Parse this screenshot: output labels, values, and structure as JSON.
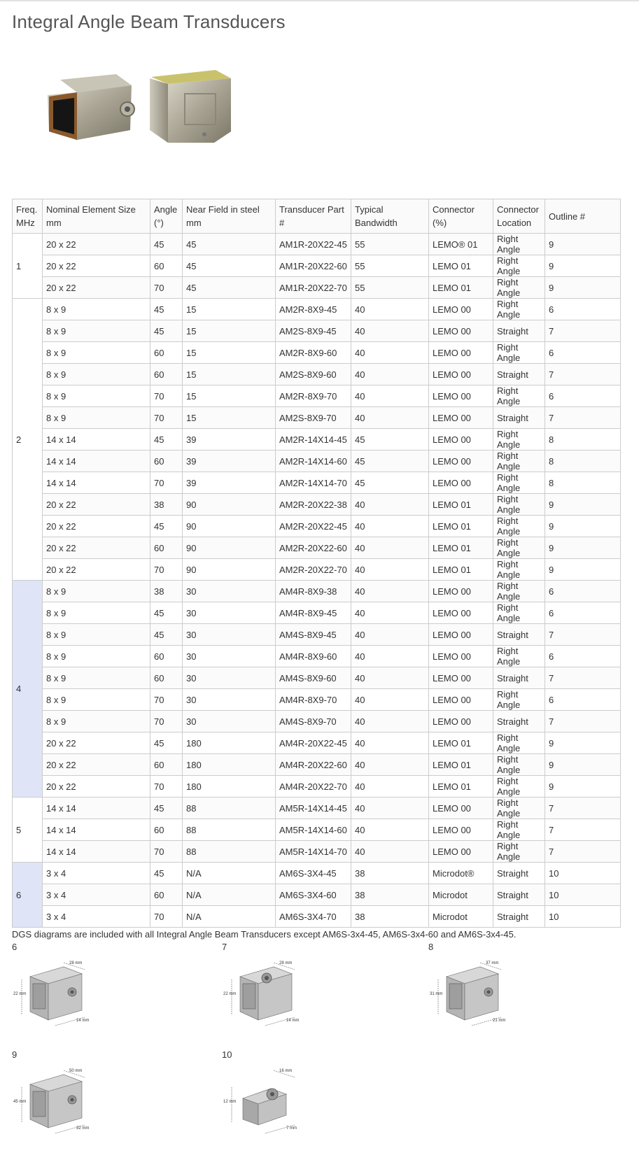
{
  "page": {
    "title": "Integral Angle Beam Transducers"
  },
  "table": {
    "headers": [
      "Freq. MHz",
      "Nominal Element Size mm",
      "Angle (°)",
      "Near Field in steel mm",
      "Transducer Part #",
      "Typical Bandwidth",
      "Connector (%)",
      "Connector Location",
      "Outline #"
    ],
    "groups": [
      {
        "freq": "1",
        "rows": [
          [
            "20 x 22",
            "45",
            "45",
            "AM1R-20X22-45",
            "55",
            "LEMO® 01",
            "Right Angle",
            "9"
          ],
          [
            "20 x 22",
            "60",
            "45",
            "AM1R-20X22-60",
            "55",
            "LEMO 01",
            "Right Angle",
            "9"
          ],
          [
            "20 x 22",
            "70",
            "45",
            "AM1R-20X22-70",
            "55",
            "LEMO 01",
            "Right Angle",
            "9"
          ]
        ]
      },
      {
        "freq": "2",
        "rows": [
          [
            "8 x 9",
            "45",
            "15",
            "AM2R-8X9-45",
            "40",
            "LEMO 00",
            "Right Angle",
            "6"
          ],
          [
            "8 x 9",
            "45",
            "15",
            "AM2S-8X9-45",
            "40",
            "LEMO 00",
            "Straight",
            "7"
          ],
          [
            "8 x 9",
            "60",
            "15",
            "AM2R-8X9-60",
            "40",
            "LEMO 00",
            "Right Angle",
            "6"
          ],
          [
            "8 x 9",
            "60",
            "15",
            "AM2S-8X9-60",
            "40",
            "LEMO 00",
            "Straight",
            "7"
          ],
          [
            "8 x 9",
            "70",
            "15",
            "AM2R-8X9-70",
            "40",
            "LEMO 00",
            "Right Angle",
            "6"
          ],
          [
            "8 x 9",
            "70",
            "15",
            "AM2S-8X9-70",
            "40",
            "LEMO 00",
            "Straight",
            "7"
          ],
          [
            "14 x 14",
            "45",
            "39",
            "AM2R-14X14-45",
            "45",
            "LEMO 00",
            "Right Angle",
            "8"
          ],
          [
            "14 x 14",
            "60",
            "39",
            "AM2R-14X14-60",
            "45",
            "LEMO 00",
            "Right Angle",
            "8"
          ],
          [
            "14 x 14",
            "70",
            "39",
            "AM2R-14X14-70",
            "45",
            "LEMO 00",
            "Right Angle",
            "8"
          ],
          [
            "20 x 22",
            "38",
            "90",
            "AM2R-20X22-38",
            "40",
            "LEMO 01",
            "Right Angle",
            "9"
          ],
          [
            "20 x 22",
            "45",
            "90",
            "AM2R-20X22-45",
            "40",
            "LEMO 01",
            "Right Angle",
            "9"
          ],
          [
            "20 x 22",
            "60",
            "90",
            "AM2R-20X22-60",
            "40",
            "LEMO 01",
            "Right Angle",
            "9"
          ],
          [
            "20 x 22",
            "70",
            "90",
            "AM2R-20X22-70",
            "40",
            "LEMO 01",
            "Right Angle",
            "9"
          ]
        ]
      },
      {
        "freq": "4",
        "rows": [
          [
            "8 x 9",
            "38",
            "30",
            "AM4R-8X9-38",
            "40",
            "LEMO 00",
            "Right Angle",
            "6"
          ],
          [
            "8 x 9",
            "45",
            "30",
            "AM4R-8X9-45",
            "40",
            "LEMO 00",
            "Right Angle",
            "6"
          ],
          [
            "8 x 9",
            "45",
            "30",
            "AM4S-8X9-45",
            "40",
            "LEMO 00",
            "Straight",
            "7"
          ],
          [
            "8 x 9",
            "60",
            "30",
            "AM4R-8X9-60",
            "40",
            "LEMO 00",
            "Right Angle",
            "6"
          ],
          [
            "8 x 9",
            "60",
            "30",
            "AM4S-8X9-60",
            "40",
            "LEMO 00",
            "Straight",
            "7"
          ],
          [
            "8 x 9",
            "70",
            "30",
            "AM4R-8X9-70",
            "40",
            "LEMO 00",
            "Right Angle",
            "6"
          ],
          [
            "8 x 9",
            "70",
            "30",
            "AM4S-8X9-70",
            "40",
            "LEMO 00",
            "Straight",
            "7"
          ],
          [
            "20 x 22",
            "45",
            "180",
            "AM4R-20X22-45",
            "40",
            "LEMO 01",
            "Right Angle",
            "9"
          ],
          [
            "20 x 22",
            "60",
            "180",
            "AM4R-20X22-60",
            "40",
            "LEMO 01",
            "Right Angle",
            "9"
          ],
          [
            "20 x 22",
            "70",
            "180",
            "AM4R-20X22-70",
            "40",
            "LEMO 01",
            "Right Angle",
            "9"
          ]
        ]
      },
      {
        "freq": "5",
        "rows": [
          [
            "14 x 14",
            "45",
            "88",
            "AM5R-14X14-45",
            "40",
            "LEMO 00",
            "Right Angle",
            "7"
          ],
          [
            "14 x 14",
            "60",
            "88",
            "AM5R-14X14-60",
            "40",
            "LEMO 00",
            "Right Angle",
            "7"
          ],
          [
            "14 x 14",
            "70",
            "88",
            "AM5R-14X14-70",
            "40",
            "LEMO 00",
            "Right Angle",
            "7"
          ]
        ]
      },
      {
        "freq": "6",
        "rows": [
          [
            "3 x 4",
            "45",
            "N/A",
            "AM6S-3X4-45",
            "38",
            "Microdot®",
            "Straight",
            "10"
          ],
          [
            "3 x 4",
            "60",
            "N/A",
            "AM6S-3X4-60",
            "38",
            "Microdot",
            "Straight",
            "10"
          ],
          [
            "3 x 4",
            "70",
            "N/A",
            "AM6S-3X4-70",
            "38",
            "Microdot",
            "Straight",
            "10"
          ]
        ]
      }
    ]
  },
  "note": "DGS diagrams are included with all Integral Angle Beam Transducers except AM6S-3x4-45, AM6S-3x4-60 and AM6S-3x4-45.",
  "outlines": [
    {
      "label": "6",
      "dims": [
        "28 mm",
        "22 mm",
        "14 mm"
      ]
    },
    {
      "label": "7",
      "dims": [
        "28 mm",
        "22 mm",
        "14 mm"
      ]
    },
    {
      "label": "8",
      "dims": [
        "37 mm",
        "31 mm",
        "21 mm"
      ]
    },
    {
      "label": "9",
      "dims": [
        "50 mm",
        "45 mm",
        "32 mm"
      ]
    },
    {
      "label": "10",
      "dims": [
        "16 mm",
        "12 mm",
        "7 mm"
      ]
    }
  ]
}
